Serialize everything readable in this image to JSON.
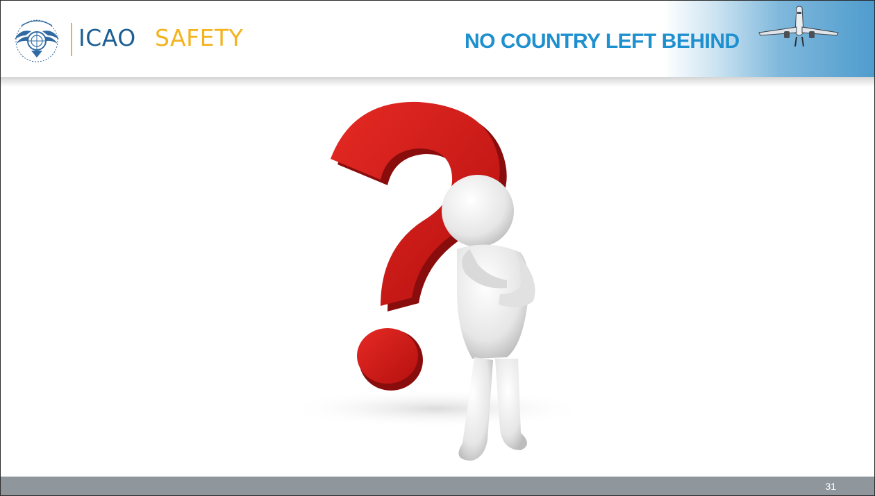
{
  "header": {
    "org_name": "ICAO",
    "section_name": "SAFETY",
    "tagline": "NO COUNTRY LEFT BEHIND",
    "logo_icon": "un-emblem-icon",
    "plane_icon": "airplane-icon"
  },
  "main": {
    "illustration_icon": "question-mark-thinking-figure-icon"
  },
  "footer": {
    "page_number": "31"
  },
  "colors": {
    "icao_blue": "#1d5f93",
    "safety_yellow": "#f3b31f",
    "tagline_blue": "#1e8fcf",
    "footer_gray": "#8f969c",
    "question_red": "#d0181b"
  }
}
